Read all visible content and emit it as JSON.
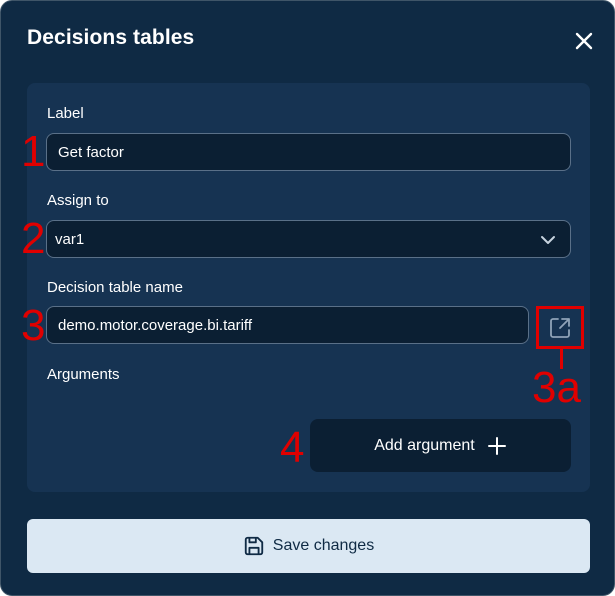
{
  "dialog": {
    "title": "Decisions tables",
    "close_icon": "close-icon"
  },
  "form": {
    "label": {
      "label": "Label",
      "value": "Get factor"
    },
    "assign_to": {
      "label": "Assign to",
      "value": "var1",
      "icon": "chevron-down-icon"
    },
    "decision_table_name": {
      "label": "Decision table name",
      "value": "demo.motor.coverage.bi.tariff",
      "open_icon": "external-link-icon"
    },
    "arguments": {
      "label": "Arguments"
    },
    "add_argument": {
      "label": "Add argument",
      "icon": "plus-icon"
    }
  },
  "footer": {
    "save_label": "Save changes",
    "save_icon": "floppy-disk-icon"
  },
  "annotations": {
    "label_field": "1",
    "assign_field": "2",
    "table_name_field": "3",
    "open_button": "3a",
    "add_argument_button": "4",
    "color": "#e00000"
  },
  "colors": {
    "dialog_bg": "#0f2a44",
    "panel_bg": "#163352",
    "input_bg": "#0b1f33",
    "save_button_bg": "#dbe8f3"
  }
}
